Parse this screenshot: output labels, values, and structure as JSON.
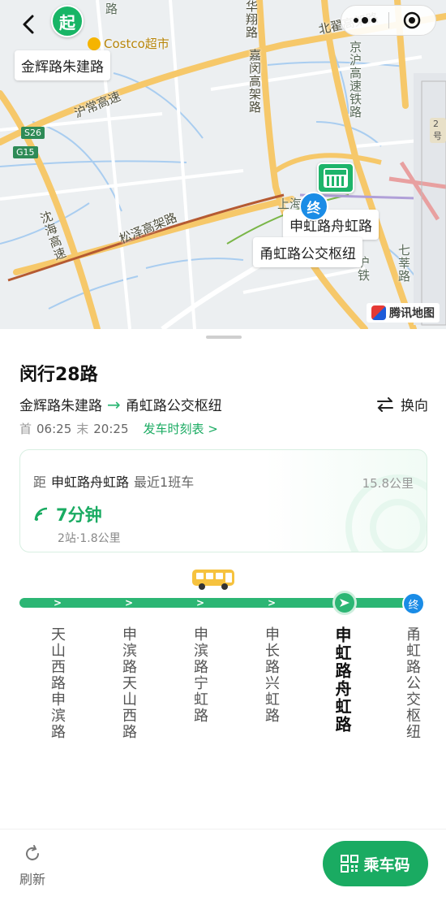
{
  "map": {
    "start_pin": "起",
    "end_pin": "终",
    "start_callout": "金辉路朱建路",
    "end_callout_1": "申虹路舟虹路",
    "end_callout_2": "甬虹路公交枢纽",
    "costco": "Costco超市",
    "labels": {
      "hu_chang": "沪常高速",
      "song_ze": "松泽高架路",
      "shen_hai": "沈海高速",
      "jia_min": "嘉闵高架路",
      "hua_xiang": "华翔路",
      "bei_zhai": "北翟高架路",
      "jing_hu": "京沪高速铁路",
      "hu_tie": "沪铁",
      "qi_xin": "七莘路",
      "shang_hai": "上海",
      "g2": "2号",
      "s26": "S26",
      "g15": "G15",
      "top_partial": "路"
    },
    "attribution": "腾讯地图"
  },
  "route": {
    "title": "闵行28路",
    "from": "金辉路朱建路",
    "to": "甬虹路公交枢纽",
    "reverse_label": "换向",
    "first_label": "首",
    "first_time": "06:25",
    "last_label": "末",
    "last_time": "20:25",
    "schedule_link": "发车时刻表 >"
  },
  "arrival": {
    "distance_prefix": "距",
    "stop": "申虹路舟虹路",
    "note": "最近1班车",
    "total_km": "15.8公里",
    "eta": "7分钟",
    "meta": "2站·1.8公里"
  },
  "stops": [
    {
      "name": "天山西路申滨路"
    },
    {
      "name": "申滨路天山西路"
    },
    {
      "name": "申滨路宁虹路"
    },
    {
      "name": "申长路兴虹路"
    },
    {
      "name": "申虹路舟虹路"
    },
    {
      "name": "甬虹路公交枢纽"
    }
  ],
  "end_node": "终",
  "bottom": {
    "refresh": "刷新",
    "ride_code": "乘车码"
  },
  "colors": {
    "accent": "#1aab62",
    "line": "#2cb674",
    "end": "#1a8ce6"
  }
}
